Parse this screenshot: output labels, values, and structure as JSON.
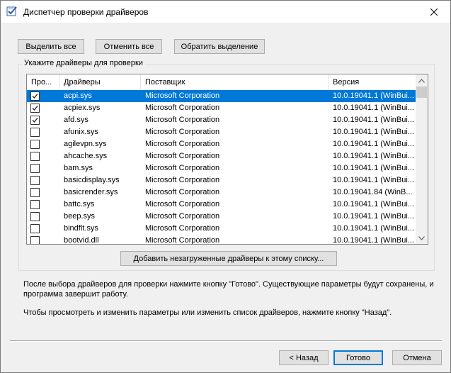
{
  "window": {
    "title": "Диспетчер проверки драйверов"
  },
  "toolbar": {
    "select_all": "Выделить все",
    "deselect_all": "Отменить все",
    "invert_selection": "Обратить выделение"
  },
  "group": {
    "label": "Укажите драйверы для проверки"
  },
  "table": {
    "columns": [
      "Про...",
      "Драйверы",
      "Поставщик",
      "Версия"
    ],
    "rows": [
      {
        "checked": true,
        "driver": "acpi.sys",
        "vendor": "Microsoft Corporation",
        "version": "10.0.19041.1 (WinBui...",
        "selected": true
      },
      {
        "checked": true,
        "driver": "acpiex.sys",
        "vendor": "Microsoft Corporation",
        "version": "10.0.19041.1 (WinBui...",
        "selected": false
      },
      {
        "checked": true,
        "driver": "afd.sys",
        "vendor": "Microsoft Corporation",
        "version": "10.0.19041.1 (WinBui...",
        "selected": false
      },
      {
        "checked": false,
        "driver": "afunix.sys",
        "vendor": "Microsoft Corporation",
        "version": "10.0.19041.1 (WinBui...",
        "selected": false
      },
      {
        "checked": false,
        "driver": "agilevpn.sys",
        "vendor": "Microsoft Corporation",
        "version": "10.0.19041.1 (WinBui...",
        "selected": false
      },
      {
        "checked": false,
        "driver": "ahcache.sys",
        "vendor": "Microsoft Corporation",
        "version": "10.0.19041.1 (WinBui...",
        "selected": false
      },
      {
        "checked": false,
        "driver": "bam.sys",
        "vendor": "Microsoft Corporation",
        "version": "10.0.19041.1 (WinBui...",
        "selected": false
      },
      {
        "checked": false,
        "driver": "basicdisplay.sys",
        "vendor": "Microsoft Corporation",
        "version": "10.0.19041.1 (WinBui...",
        "selected": false
      },
      {
        "checked": false,
        "driver": "basicrender.sys",
        "vendor": "Microsoft Corporation",
        "version": "10.0.19041.84 (WinB...",
        "selected": false
      },
      {
        "checked": false,
        "driver": "battc.sys",
        "vendor": "Microsoft Corporation",
        "version": "10.0.19041.1 (WinBui...",
        "selected": false
      },
      {
        "checked": false,
        "driver": "beep.sys",
        "vendor": "Microsoft Corporation",
        "version": "10.0.19041.1 (WinBui...",
        "selected": false
      },
      {
        "checked": false,
        "driver": "bindflt.sys",
        "vendor": "Microsoft Corporation",
        "version": "10.0.19041.1 (WinBui...",
        "selected": false
      },
      {
        "checked": false,
        "driver": "bootvid.dll",
        "vendor": "Microsoft Corporation",
        "version": "10.0.19041.1 (WinBui...",
        "selected": false
      }
    ]
  },
  "add_unloaded_button": "Добавить незагруженные драйверы к этому списку...",
  "info": {
    "line1": "После выбора драйверов для проверки нажмите кнопку \"Готово\". Существующие параметры будут сохранены, и программа завершит работу.",
    "line2": "Чтобы просмотреть и изменить параметры или изменить список драйверов, нажмите кнопку \"Назад\"."
  },
  "footer": {
    "back": "< Назад",
    "finish": "Готово",
    "cancel": "Отмена"
  },
  "colors": {
    "selection": "#0078d7",
    "window_bg": "#f0f0f0"
  }
}
